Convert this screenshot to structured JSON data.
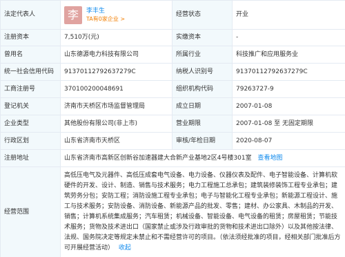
{
  "rows": {
    "legal_rep": {
      "label": "法定代表人",
      "avatar_char": "李",
      "name": "李丰生",
      "related": "TA有0家企业 >",
      "status_label": "经营状态",
      "status_value": "开业"
    },
    "capital": {
      "label": "注册资本",
      "value": "7,510万(元)",
      "paid_label": "实缴资本",
      "paid_value": "-"
    },
    "former": {
      "label": "曾用名",
      "value": "山东德源电力科技有限公司",
      "industry_label": "所属行业",
      "industry_value": "科技推广和应用服务业"
    },
    "credit": {
      "label": "统一社会信用代码",
      "value": "91370112792637279C",
      "taxpayer_label": "纳税人识别号",
      "taxpayer_value": "91370112792637279C"
    },
    "reg_no": {
      "label": "工商注册号",
      "value": "370100200048691",
      "org_label": "组织机构代码",
      "org_value": "79263727-9"
    },
    "authority": {
      "label": "登记机关",
      "value": "济南市天桥区市场监督管理局",
      "founded_label": "成立日期",
      "founded_value": "2007-01-08"
    },
    "type": {
      "label": "企业类型",
      "value": "其他股份有限公司(非上市)",
      "term_label": "营业期限",
      "term_value": "2007-01-08 至 无固定期限"
    },
    "district": {
      "label": "行政区划",
      "value": "山东省济南市天桥区",
      "approval_label": "审核/年检日期",
      "approval_value": "2020-08-07"
    },
    "address": {
      "label": "注册地址",
      "value": "山东省济南市高新区创新谷加速器建大合新产业基地2区4号楼301室",
      "map_link": "查看地图"
    },
    "scope": {
      "label": "经营范围",
      "text": "高低压电气及元器件、高低压成套电气设备、电力设备、仪器仪表及配件、电子智能设备、计算机软硬件的开发、设计、制造、销售与技术服务；电力工程施工总承包；建筑装修装饰工程专业承包；建筑劳务分包；安防工程；消防设施工程专业承包；电子与智能化工程专业承包；新能源工程设计、施工与技术服务；安防设备、消防设备、新能源产品的批发、零售；建材、办公家具、木制品的开发、销售；计算机系统集成服务；汽车租赁；机械设备、智能设备、电气设备的租赁；房屋租赁；节能技术服务；货物及技术进出口（国家禁止或涉及行政审批的货物和技术进出口除外）以及其他按法律、法规、国务院决定等规定未禁止和不需经营许可的项目。（依法须经批准的项目，经相关部门批准后方可开展经营活动）",
      "collapse_link": "收起"
    }
  },
  "colors": {
    "label_bg": "#f2f9fc",
    "border": "#e4eaf2",
    "link": "#128bed",
    "related": "#f27e00",
    "avatar_bg": "#e0a3a0"
  }
}
